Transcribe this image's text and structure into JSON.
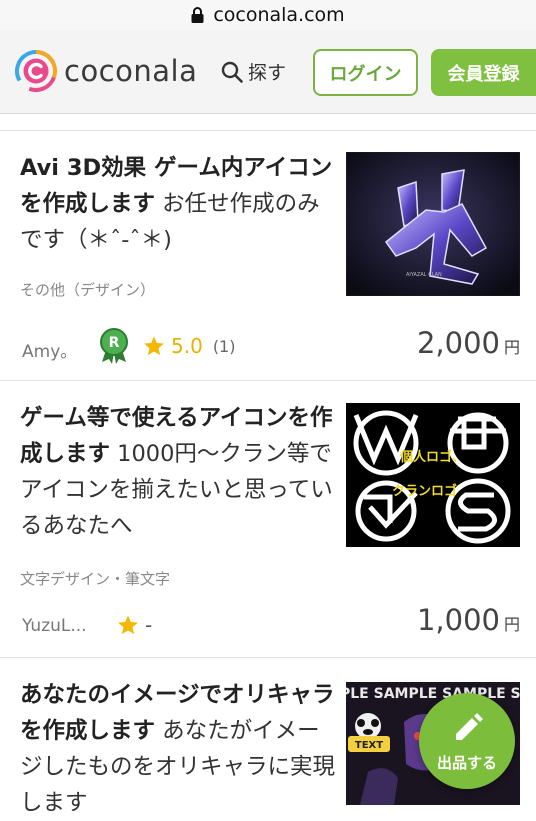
{
  "browser": {
    "url": "coconala.com"
  },
  "header": {
    "logo_text": "coconala",
    "search_label": "探す",
    "login_label": "ログイン",
    "register_label": "会員登録"
  },
  "services": [
    {
      "title_bold": "Avi 3D効果 ゲーム内アイコンを作成します",
      "title_desc": "お任せ作成のみです（＊ˆ-ˆ＊)",
      "category": "その他（デザイン）",
      "seller": "Amy。",
      "rating": "5.0",
      "review_count": "(1)",
      "price": "2,000",
      "currency": "円",
      "thumbnail_text": "AIYAZAL CLAN"
    },
    {
      "title_bold": "ゲーム等で使えるアイコンを作成します",
      "title_desc": "1000円〜クラン等でアイコンを揃えたいと思っているあなたへ",
      "category": "文字デザイン・筆文字",
      "seller": "YuzuL...",
      "rating": "-",
      "price": "1,000",
      "currency": "円",
      "thumbnail_labels": [
        "個人ロゴ、",
        "クランロゴ"
      ]
    },
    {
      "title_bold": "あなたのイメージでオリキャラを作成します",
      "title_desc": "あなたがイメージしたものをオリキャラに実現します",
      "thumbnail_text": "PLE SAMPLE SAMPLE SAMP",
      "thumbnail_badge": "TEXT"
    }
  ],
  "fab": {
    "label": "出品する"
  },
  "colors": {
    "brand_green": "#80c040",
    "star": "#f5b800"
  }
}
